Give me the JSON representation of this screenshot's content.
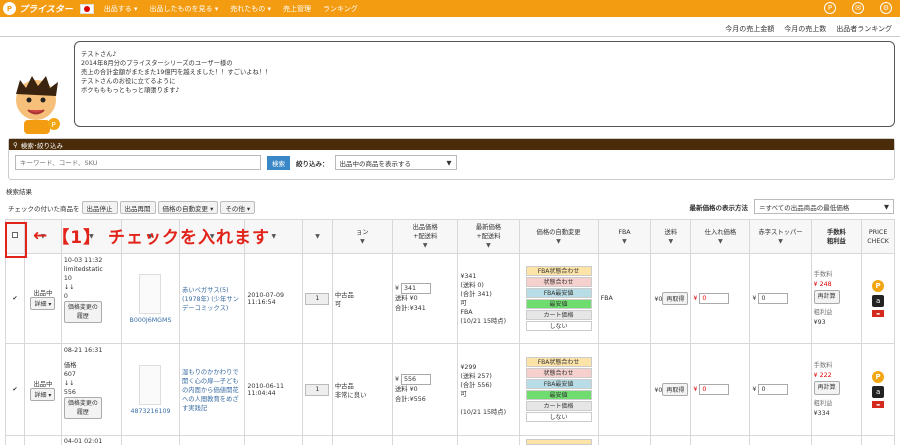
{
  "header": {
    "logo_text": "プライスター",
    "nav": [
      "出品する ▾",
      "出品したものを見る ▾",
      "売れたもの ▾",
      "売上管理",
      "ランキング"
    ],
    "right_icons": [
      "P",
      "✉",
      "⚙"
    ]
  },
  "sublinks": [
    "今月の売上金額",
    "今月の売上数",
    "出品者ランキング"
  ],
  "message": {
    "lines": [
      "テストさん♪",
      "",
      "2014年8月分のプライスターシリーズのユーザー様の",
      "売上の合計金額がまたまた19億円を越えました！！すごいよね！！",
      "",
      "テストさんのお役に立てるように",
      "ボクもももっともっと頑張ります♪"
    ]
  },
  "search": {
    "title": "検索･絞り込み",
    "placeholder": "キーワード、コード、SKU",
    "button": "検索",
    "filter_label": "絞り込み：",
    "filter_value": "出品中の商品を表示する"
  },
  "results_label": "検索結果",
  "toolbar": {
    "prefix": "チェックの付いた商品を",
    "buttons": [
      "出品停止",
      "出品再開",
      "価格の自動変更 ▾",
      "その他 ▾"
    ]
  },
  "latest_price": {
    "label": "最新価格の表示方法",
    "value": "＝すべての出品商品の最低価格"
  },
  "columns": [
    "",
    "",
    "",
    "",
    "",
    "",
    "",
    "ョン",
    "出品価格\n+配送料",
    "最新価格\n+配送料",
    "価格の自動変更",
    "FBA",
    "送料",
    "仕入れ価格",
    "赤字ストッパー",
    "手数料\n粗利益",
    "PRICE\nCHECK"
  ],
  "annotation": "【1】 チェックを入れます",
  "rows": [
    {
      "date": "10-03 11:32",
      "status": "出品中",
      "detail": "詳細 ▾",
      "sku": "limitedstatic",
      "qty_num": "10",
      "arrows": "↓↓",
      "zero": "0",
      "history_btn": "価格変更の\n履歴",
      "asin": "B000J6MGMS",
      "title": "赤いペガサス(5) (1978年) (少年サンデーコミックス)",
      "listed": "2010-07-09\n11:16:54",
      "qty": "1",
      "condition": "中古品\n可",
      "price_val": "341",
      "price_ship": "送料 ¥0",
      "price_total": "合計:¥341",
      "latest": "¥341\n(送料 0)\n(合計 341)\n可\nFBA\n(10/21 15時点)",
      "fba": "FBA",
      "shipping": "¥0",
      "refetch": "再取得",
      "cost": "0",
      "stopper": "0",
      "fee_label": "手数料",
      "fee": "¥ 248",
      "recalc": "再計算",
      "profit_label": "粗利益",
      "profit": "¥93"
    },
    {
      "date": "08-21 16:31",
      "status": "出品中",
      "detail": "詳細 ▾",
      "sku": "価格",
      "qty_num": "607",
      "arrows": "↓↓",
      "zero": "556",
      "history_btn": "価格変更の\n履歴",
      "asin": "4873216109",
      "title": "湿もりのかかわりで開く心の扉―子どもの内面から価値開花への人間教育をめざす実践記",
      "listed": "2010-06-11\n11:04:44",
      "qty": "1",
      "condition": "中古品\n非常に良い",
      "price_val": "556",
      "price_ship": "送料 ¥0",
      "price_total": "合計:¥556",
      "latest": "¥299\n(送料 257)\n(合計 556)\n可\n\n(10/21 15時点)",
      "fba": "",
      "shipping": "¥0",
      "refetch": "再取得",
      "cost": "0",
      "stopper": "0",
      "fee_label": "手数料",
      "fee": "¥ 222",
      "recalc": "再計算",
      "profit_label": "粗利益",
      "profit": "¥334"
    }
  ],
  "row3_date": "04-01 02:01",
  "auto_tags": [
    "FBA状態合わせ",
    "状態合わせ",
    "FBA最安値",
    "最安値",
    "カート価格",
    "しない"
  ],
  "colors": {
    "orange": "#f39c12",
    "brown": "#4a2c0a",
    "red": "#e2231a",
    "blue": "#3a87c7"
  }
}
